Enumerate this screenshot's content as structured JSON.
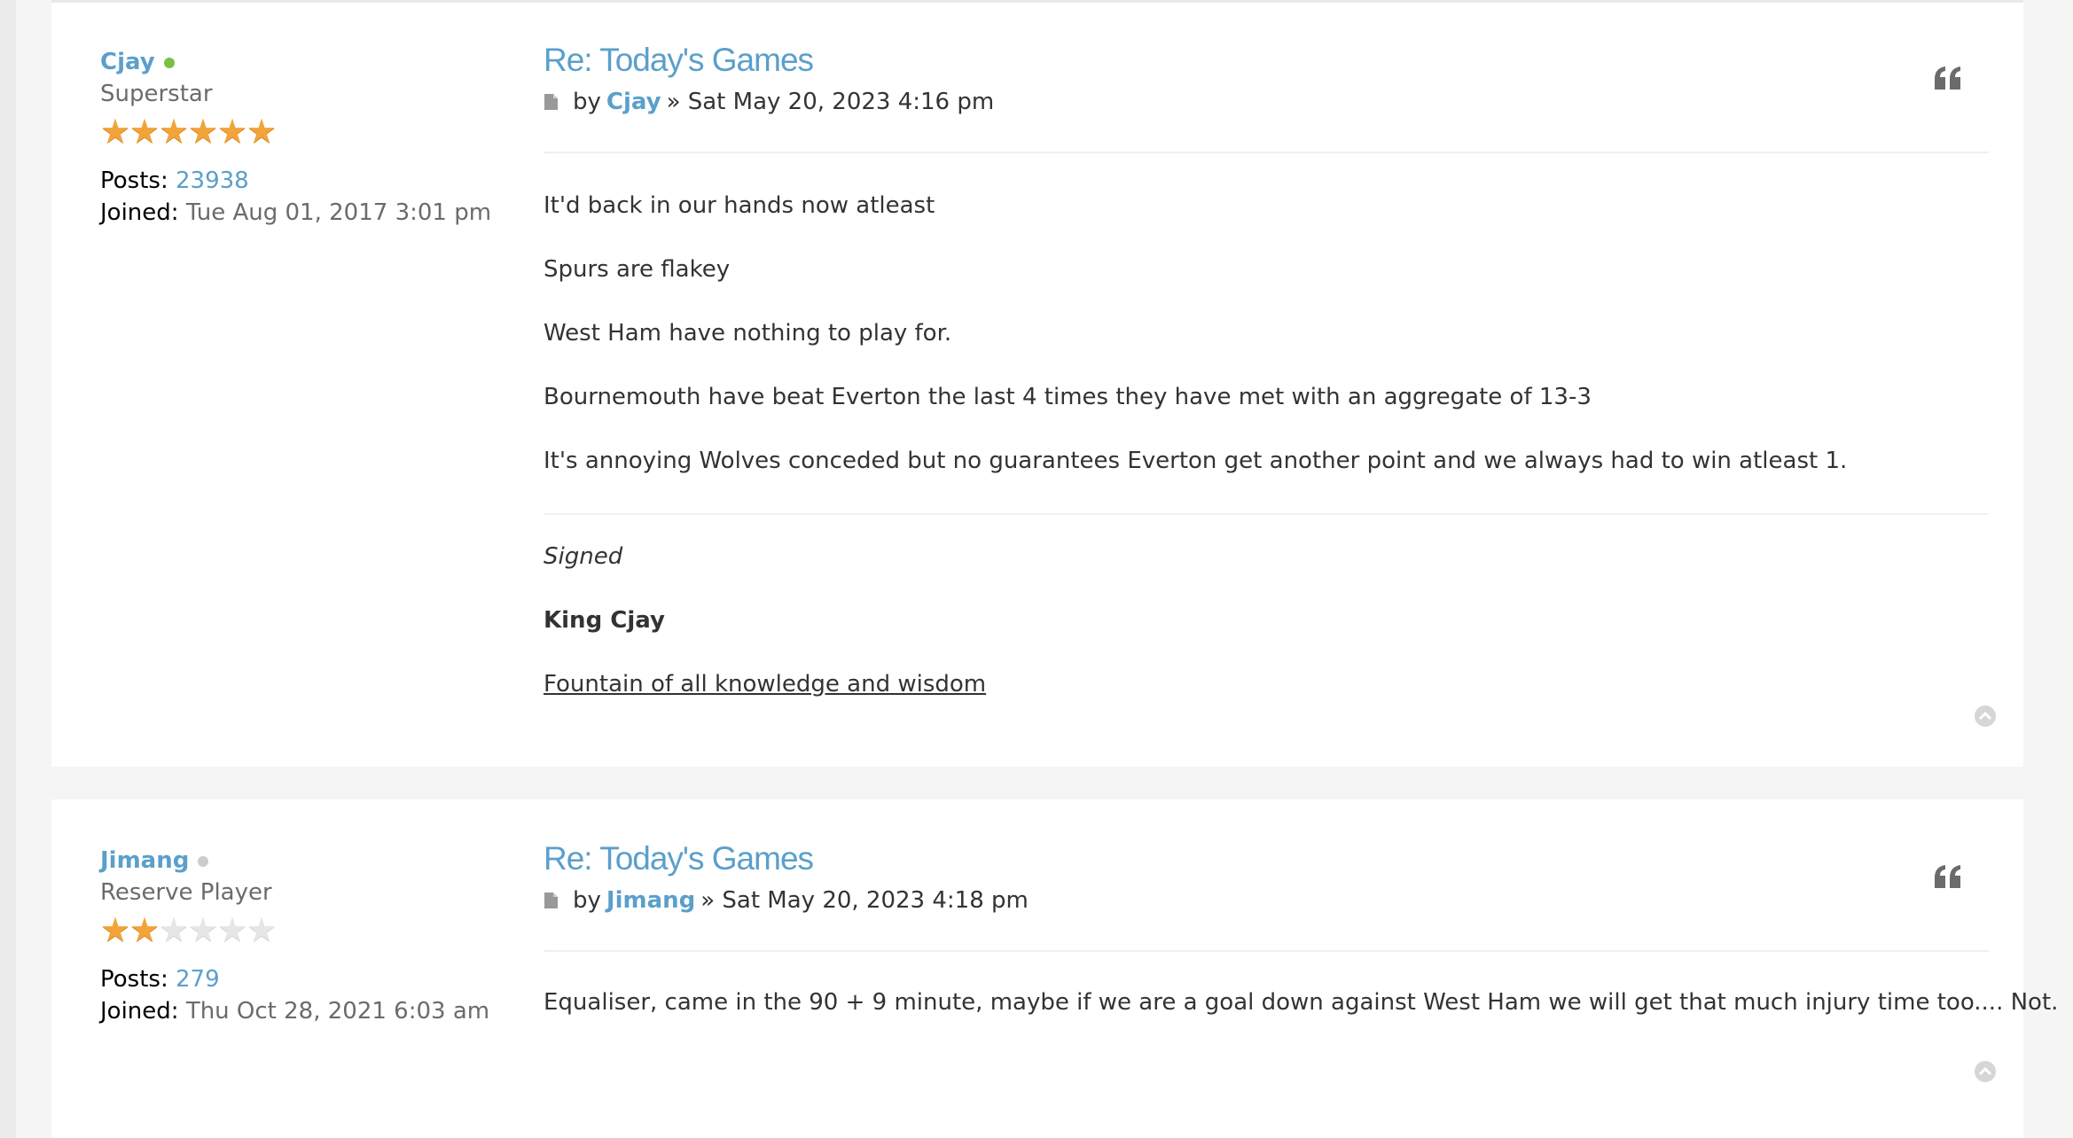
{
  "posts": [
    {
      "author": {
        "name": "Cjay",
        "online": true,
        "rank": "Superstar",
        "stars_filled": 6,
        "stars_total": 6,
        "posts_label": "Posts:",
        "posts_count": "23938",
        "joined_label": "Joined:",
        "joined_date": "Tue Aug 01, 2017 3:01 pm"
      },
      "title": "Re: Today's Games",
      "meta_by": "by",
      "meta_author": "Cjay",
      "meta_date": "» Sat May 20, 2023 4:16 pm",
      "content": [
        "It'd back in our hands now atleast",
        "Spurs are flakey",
        "West Ham have nothing to play for.",
        "Bournemouth have beat Everton the last 4 times they have met with an aggregate of 13-3",
        "It's annoying Wolves conceded but no guarantees Everton get another point and we always had to win atleast 1."
      ],
      "signature": {
        "line1": "Signed",
        "line2": "King Cjay",
        "line3": "Fountain of all knowledge and wisdom"
      }
    },
    {
      "author": {
        "name": "Jimang",
        "online": false,
        "rank": "Reserve Player",
        "stars_filled": 2,
        "stars_total": 6,
        "posts_label": "Posts:",
        "posts_count": "279",
        "joined_label": "Joined:",
        "joined_date": "Thu Oct 28, 2021 6:03 am"
      },
      "title": "Re: Today's Games",
      "meta_by": "by",
      "meta_author": "Jimang",
      "meta_date": "» Sat May 20, 2023 4:18 pm",
      "content": [
        "Equaliser, came in the 90 + 9 minute, maybe if we are a goal down against West Ham we will get that much injury time too.... Not."
      ]
    }
  ],
  "icons": {
    "quote": "quote-icon",
    "back_to_top": "chevron-up-circle-icon",
    "post_link": "file-icon"
  },
  "colors": {
    "link": "#5b9fcb",
    "online": "#7ac143",
    "offline": "#cccccc",
    "star": "#f2a43a"
  }
}
